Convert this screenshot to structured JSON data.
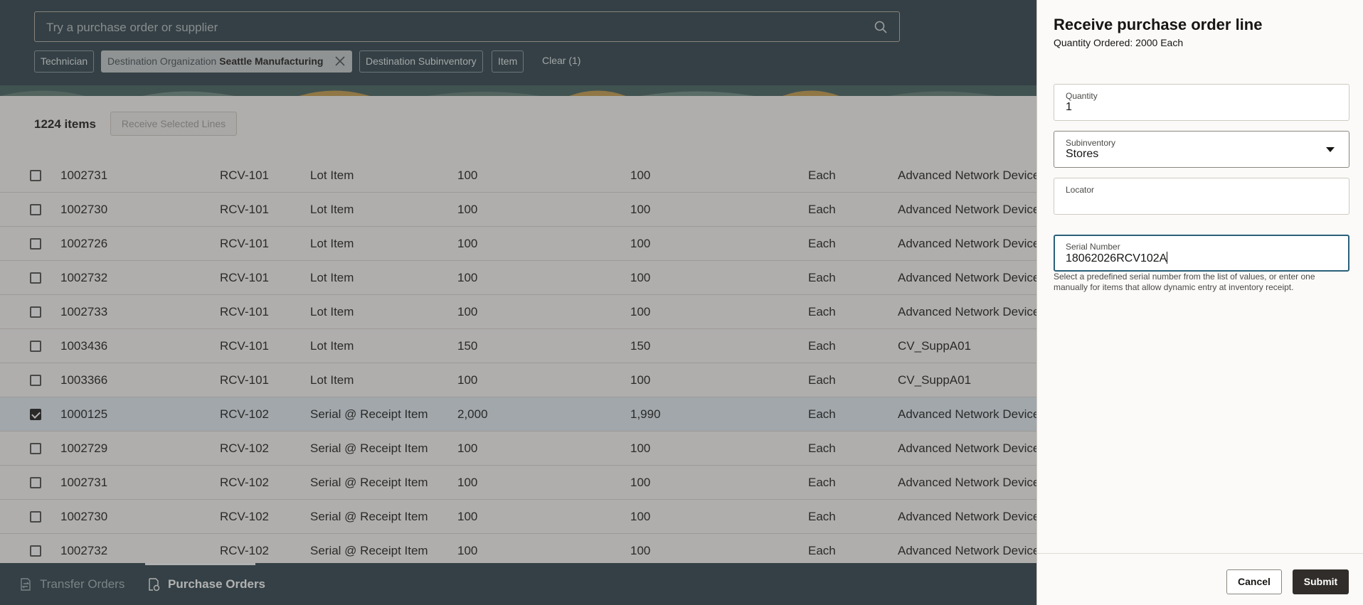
{
  "search": {
    "placeholder": "Try a purchase order or supplier"
  },
  "filters": {
    "technician": "Technician",
    "dest_org_label": "Destination Organization",
    "dest_org_value": "Seattle Manufacturing",
    "dest_subinventory": "Destination Subinventory",
    "item": "Item",
    "clear": "Clear (1)"
  },
  "toolbar": {
    "count": "1224 items",
    "receive_selected": "Receive Selected Lines"
  },
  "rows": [
    {
      "po": "1002731",
      "item": "RCV-101",
      "desc": "Lot Item",
      "ordered": "100",
      "remaining": "100",
      "uom": "Each",
      "supplier": "Advanced Network Devices",
      "checked": false
    },
    {
      "po": "1002730",
      "item": "RCV-101",
      "desc": "Lot Item",
      "ordered": "100",
      "remaining": "100",
      "uom": "Each",
      "supplier": "Advanced Network Devices",
      "checked": false
    },
    {
      "po": "1002726",
      "item": "RCV-101",
      "desc": "Lot Item",
      "ordered": "100",
      "remaining": "100",
      "uom": "Each",
      "supplier": "Advanced Network Devices",
      "checked": false
    },
    {
      "po": "1002732",
      "item": "RCV-101",
      "desc": "Lot Item",
      "ordered": "100",
      "remaining": "100",
      "uom": "Each",
      "supplier": "Advanced Network Devices",
      "checked": false
    },
    {
      "po": "1002733",
      "item": "RCV-101",
      "desc": "Lot Item",
      "ordered": "100",
      "remaining": "100",
      "uom": "Each",
      "supplier": "Advanced Network Devices",
      "checked": false
    },
    {
      "po": "1003436",
      "item": "RCV-101",
      "desc": "Lot Item",
      "ordered": "150",
      "remaining": "150",
      "uom": "Each",
      "supplier": "CV_SuppA01",
      "checked": false
    },
    {
      "po": "1003366",
      "item": "RCV-101",
      "desc": "Lot Item",
      "ordered": "100",
      "remaining": "100",
      "uom": "Each",
      "supplier": "CV_SuppA01",
      "checked": false
    },
    {
      "po": "1000125",
      "item": "RCV-102",
      "desc": "Serial @ Receipt Item",
      "ordered": "2,000",
      "remaining": "1,990",
      "uom": "Each",
      "supplier": "Advanced Network Devices",
      "checked": true
    },
    {
      "po": "1002729",
      "item": "RCV-102",
      "desc": "Serial @ Receipt Item",
      "ordered": "100",
      "remaining": "100",
      "uom": "Each",
      "supplier": "Advanced Network Devices",
      "checked": false
    },
    {
      "po": "1002731",
      "item": "RCV-102",
      "desc": "Serial @ Receipt Item",
      "ordered": "100",
      "remaining": "100",
      "uom": "Each",
      "supplier": "Advanced Network Devices",
      "checked": false
    },
    {
      "po": "1002730",
      "item": "RCV-102",
      "desc": "Serial @ Receipt Item",
      "ordered": "100",
      "remaining": "100",
      "uom": "Each",
      "supplier": "Advanced Network Devices",
      "checked": false
    },
    {
      "po": "1002732",
      "item": "RCV-102",
      "desc": "Serial @ Receipt Item",
      "ordered": "100",
      "remaining": "100",
      "uom": "Each",
      "supplier": "Advanced Network Devices",
      "checked": false
    }
  ],
  "footer_tabs": {
    "transfer_orders": "Transfer Orders",
    "purchase_orders": "Purchase Orders"
  },
  "drawer": {
    "title": "Receive purchase order line",
    "subtitle": "Quantity Ordered: 2000 Each",
    "quantity_label": "Quantity",
    "quantity_value": "1",
    "subinventory_label": "Subinventory",
    "subinventory_value": "Stores",
    "locator_label": "Locator",
    "locator_value": "",
    "serial_label": "Serial Number",
    "serial_value": "18062026RCV102A",
    "serial_help": "Select a predefined serial number from the list of values, or enter one manually for items that allow dynamic entry at inventory receipt.",
    "cancel": "Cancel",
    "submit": "Submit"
  },
  "colors": {
    "header": "#283d46",
    "accent": "#2b5f7a",
    "submit": "#312d2a"
  }
}
